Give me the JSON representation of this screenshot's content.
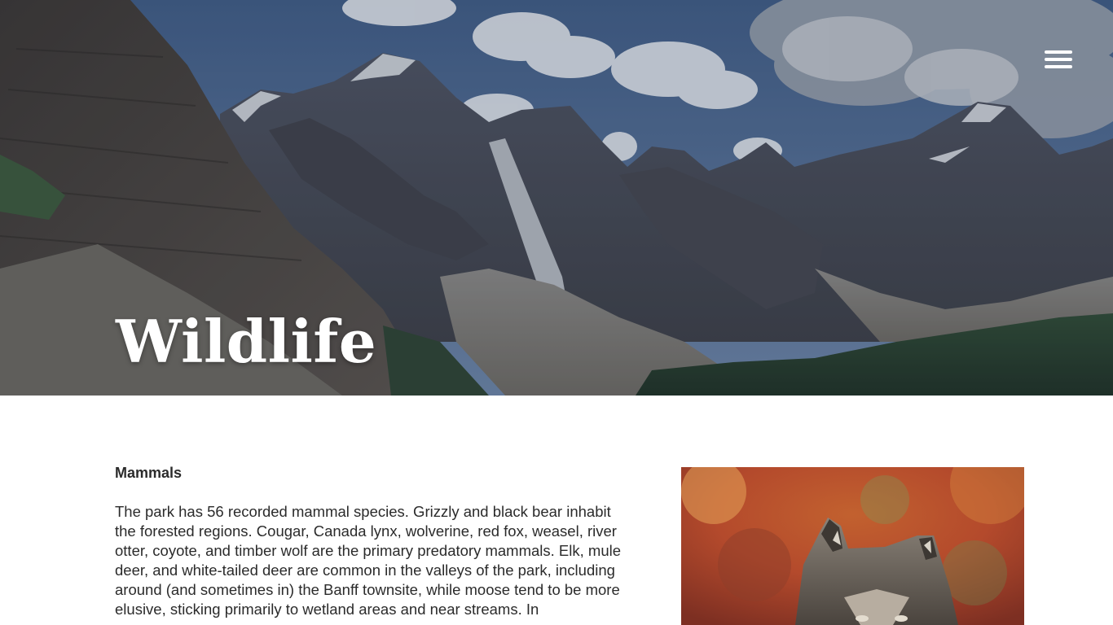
{
  "hero": {
    "title": "Wildlife",
    "background_image": "mountain-valley-landscape"
  },
  "menu": {
    "icon": "hamburger-menu-icon"
  },
  "section": {
    "heading": "Mammals",
    "body": "The park has 56 recorded mammal species. Grizzly and black bear inhabit the forested regions. Cougar, Canada lynx, wolverine, red fox, weasel, river otter, coyote, and timber wolf are the primary predatory mammals. Elk, mule deer, and white-tailed deer are common in the valleys of the park, including around (and sometimes in) the Banff townsite, while moose tend to be more elusive, sticking primarily to wetland areas and near streams. In",
    "image": "grey-wolf-photo"
  },
  "colors": {
    "text": "#2b2b2b",
    "background": "#ffffff",
    "hero_title": "#ffffff"
  }
}
